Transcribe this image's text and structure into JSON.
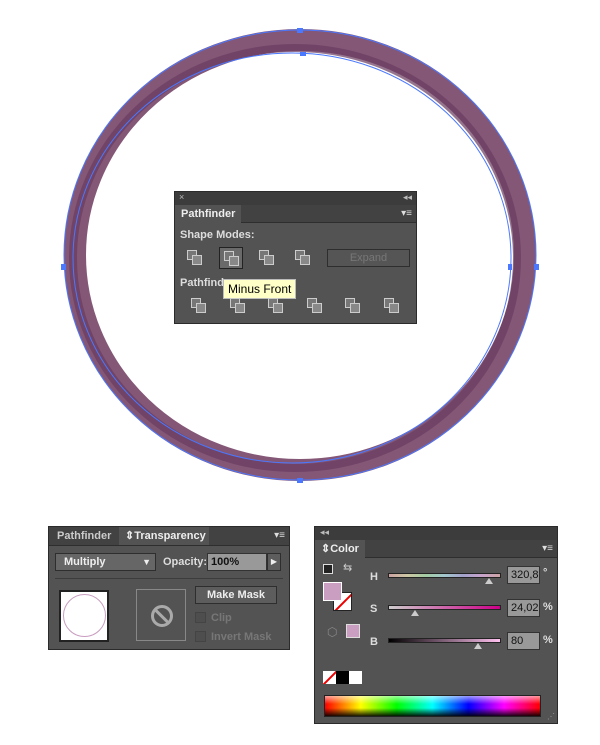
{
  "colors": {
    "ring": "#845777",
    "ring_dark": "#6a3a60",
    "selection": "#4a78ff",
    "panel": "#535353",
    "swatch": "#c99ec0"
  },
  "pathfinder": {
    "tab": "Pathfinder",
    "shape_modes_label": "Shape Modes:",
    "expand_label": "Expand",
    "pathfinders_label": "Pathfind",
    "tooltip": "Minus Front",
    "close": "×",
    "collapse": "◂◂",
    "menu": "▾≡"
  },
  "transparency": {
    "tabs": [
      "Pathfinder",
      "Transparency"
    ],
    "blend_mode": "Multiply",
    "opacity_label": "Opacity:",
    "opacity_value": "100%",
    "make_mask": "Make Mask",
    "clip": "Clip",
    "invert_mask": "Invert Mask",
    "menu": "▾≡"
  },
  "color": {
    "tab": "Color",
    "collapse": "◂◂",
    "menu": "▾≡",
    "h_label": "H",
    "h_value": "320,8",
    "h_unit": "°",
    "s_label": "S",
    "s_value": "24,02",
    "s_unit": "%",
    "b_label": "B",
    "b_value": "80",
    "b_unit": "%",
    "h": 320.8,
    "s": 24.02,
    "b": 80
  }
}
